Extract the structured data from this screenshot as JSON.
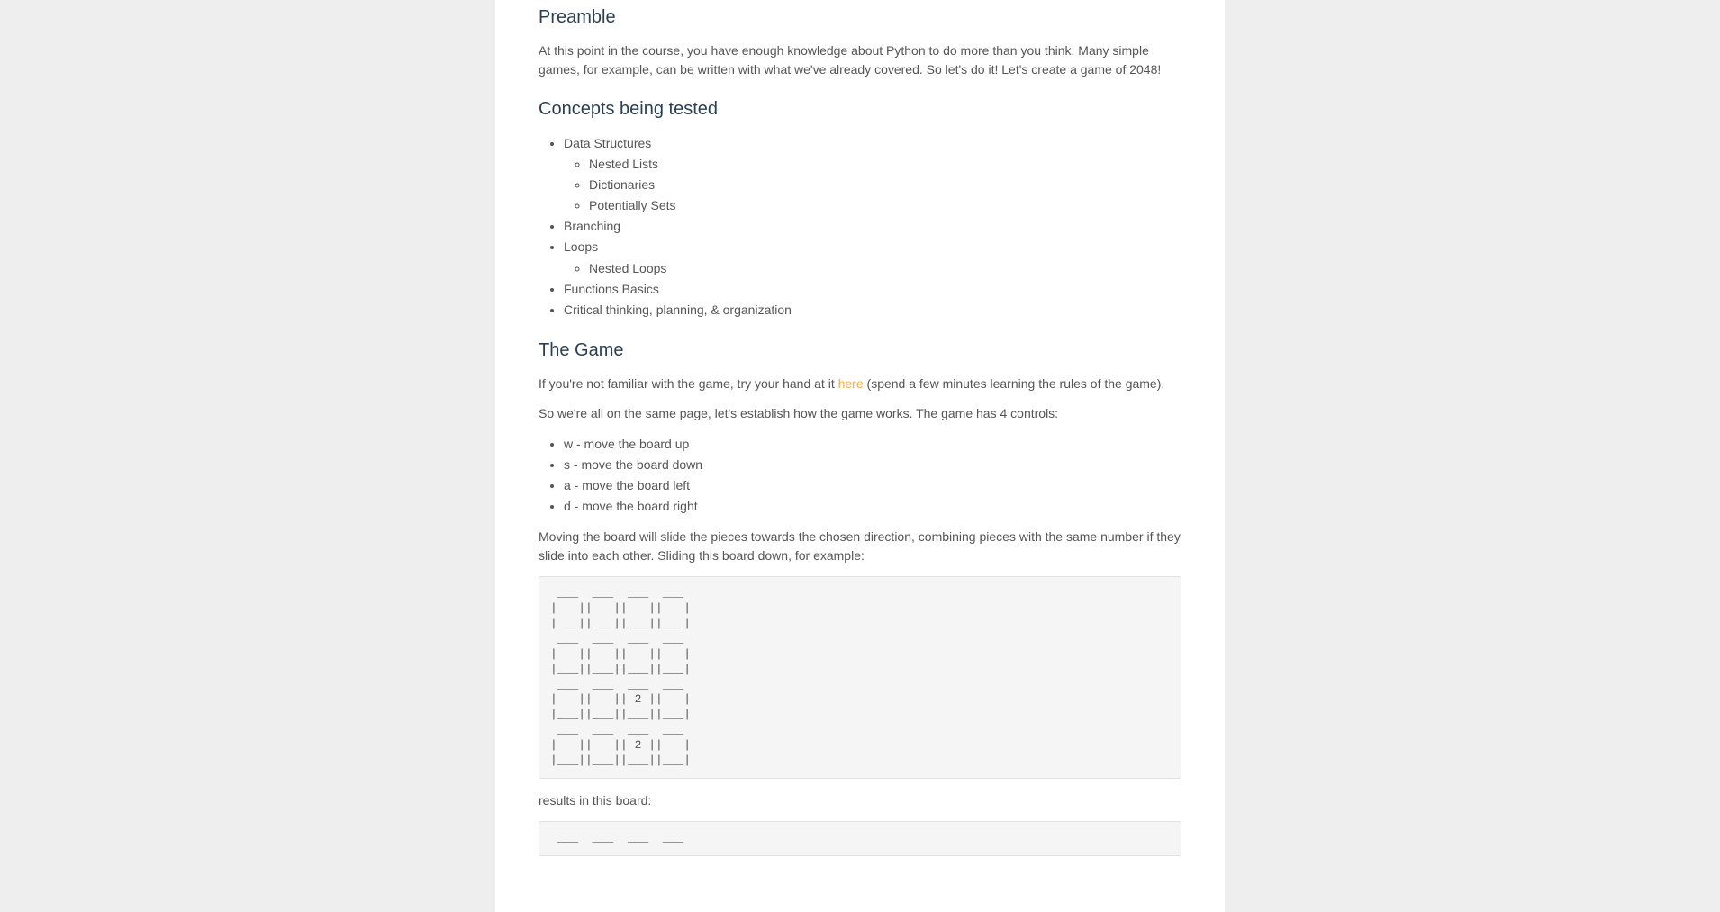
{
  "headings": {
    "preamble": "Preamble",
    "concepts": "Concepts being tested",
    "game": "The Game"
  },
  "paragraphs": {
    "preamble_p1": "At this point in the course, you have enough knowledge about Python to do more than you think. Many simple games, for example, can be written with what we've already covered. So let's do it! Let's create a game of 2048!",
    "game_p1_pre": "If you're not familiar with the game, try your hand at it ",
    "game_link": "here",
    "game_p1_post": " (spend a few minutes learning the rules of the game).",
    "game_p2": "So we're all on the same page, let's establish how the game works. The game has 4 controls:",
    "game_p3": "Moving the board will slide the pieces towards the chosen direction, combining pieces with the same number if they slide into each other. Sliding this board down, for example:",
    "result_p": "results in this board:"
  },
  "concepts_list": {
    "data_structures": "Data Structures",
    "nested_lists": "Nested Lists",
    "dictionaries": "Dictionaries",
    "potentially_sets": "Potentially Sets",
    "branching": "Branching",
    "loops": "Loops",
    "nested_loops": "Nested Loops",
    "functions": "Functions Basics",
    "critical": "Critical thinking, planning, & organization"
  },
  "controls_list": {
    "w": "w - move the board up",
    "s": "s - move the board down",
    "a": "a - move the board left",
    "d": "d - move the board right"
  },
  "board1": " ___  ___  ___  ___\n|   ||   ||   ||   |\n|___||___||___||___|\n ___  ___  ___  ___\n|   ||   ||   ||   |\n|___||___||___||___|\n ___  ___  ___  ___\n|   ||   || 2 ||   |\n|___||___||___||___|\n ___  ___  ___  ___\n|   ||   || 2 ||   |\n|___||___||___||___|",
  "board2": " ___  ___  ___  ___"
}
